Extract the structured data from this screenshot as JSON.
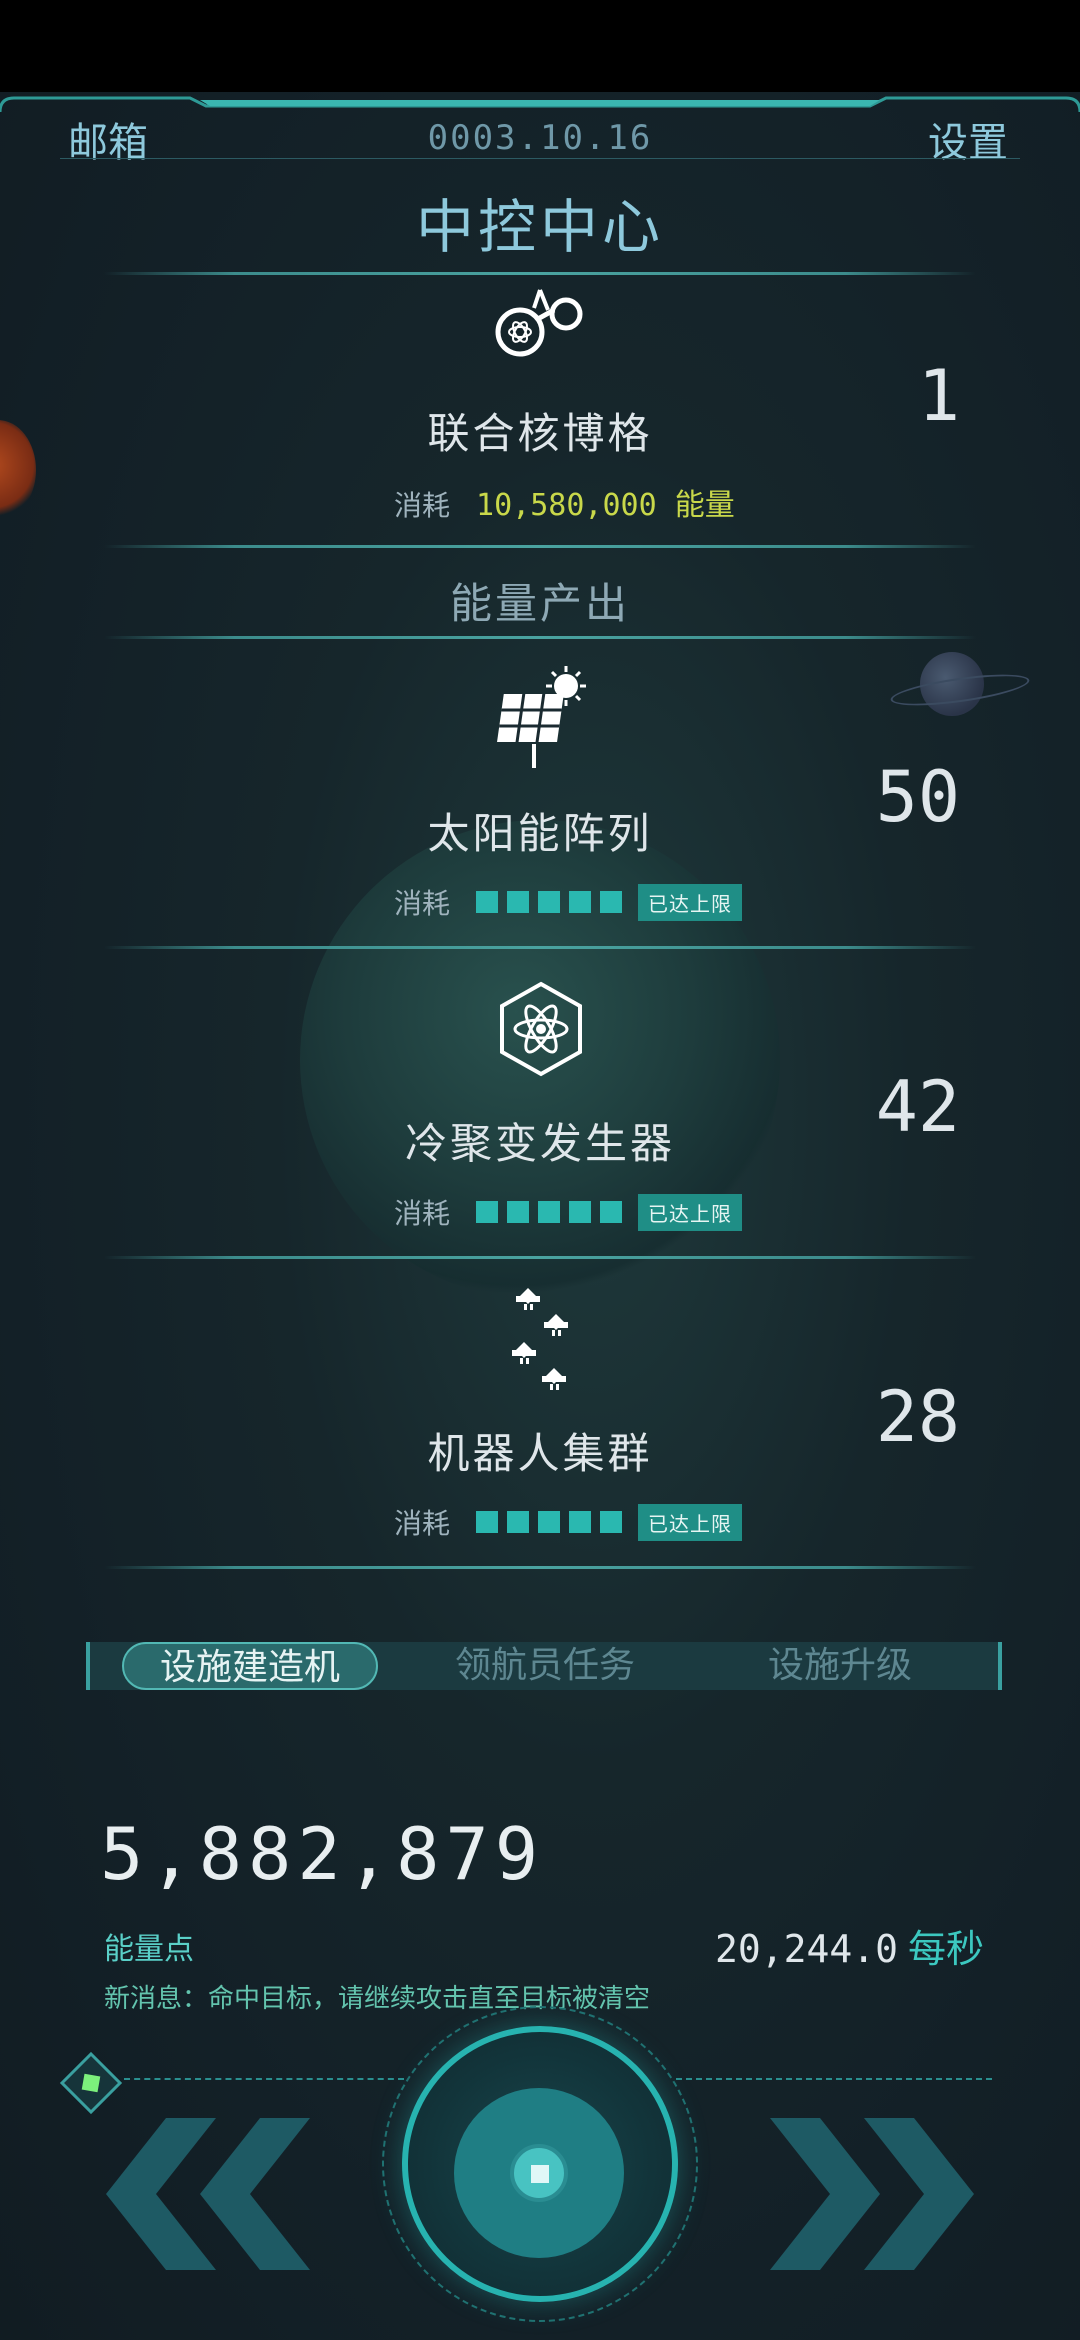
{
  "header": {
    "mail_label": "邮箱",
    "date": "0003.10.16",
    "settings_label": "设置"
  },
  "title": "中控中心",
  "main_facility": {
    "name": "联合核博格",
    "count": "1",
    "consume_label": "消耗",
    "consume_value": "10,580,000",
    "consume_unit": "能量"
  },
  "section_title": "能量产出",
  "facilities": [
    {
      "name": "太阳能阵列",
      "count": "50",
      "consume_label": "消耗",
      "level": 5,
      "level_max": 5,
      "badge": "已达上限",
      "icon": "solar-panel-icon"
    },
    {
      "name": "冷聚变发生器",
      "count": "42",
      "consume_label": "消耗",
      "level": 5,
      "level_max": 5,
      "badge": "已达上限",
      "icon": "atom-hexagon-icon"
    },
    {
      "name": "机器人集群",
      "count": "28",
      "consume_label": "消耗",
      "level": 5,
      "level_max": 5,
      "badge": "已达上限",
      "icon": "robot-swarm-icon"
    }
  ],
  "tabs": [
    {
      "label": "设施建造机",
      "active": true
    },
    {
      "label": "领航员任务",
      "active": false
    },
    {
      "label": "设施升级",
      "active": false
    }
  ],
  "energy": {
    "value": "5,882,879",
    "label": "能量点",
    "rate_value": "20,244.0",
    "rate_unit": "每秒"
  },
  "message": "新消息：命中目标，请继续攻击直至目标被清空",
  "colors": {
    "accent": "#2ab8b0",
    "yellow": "#c9d84a",
    "title": "#8ec9dc"
  }
}
